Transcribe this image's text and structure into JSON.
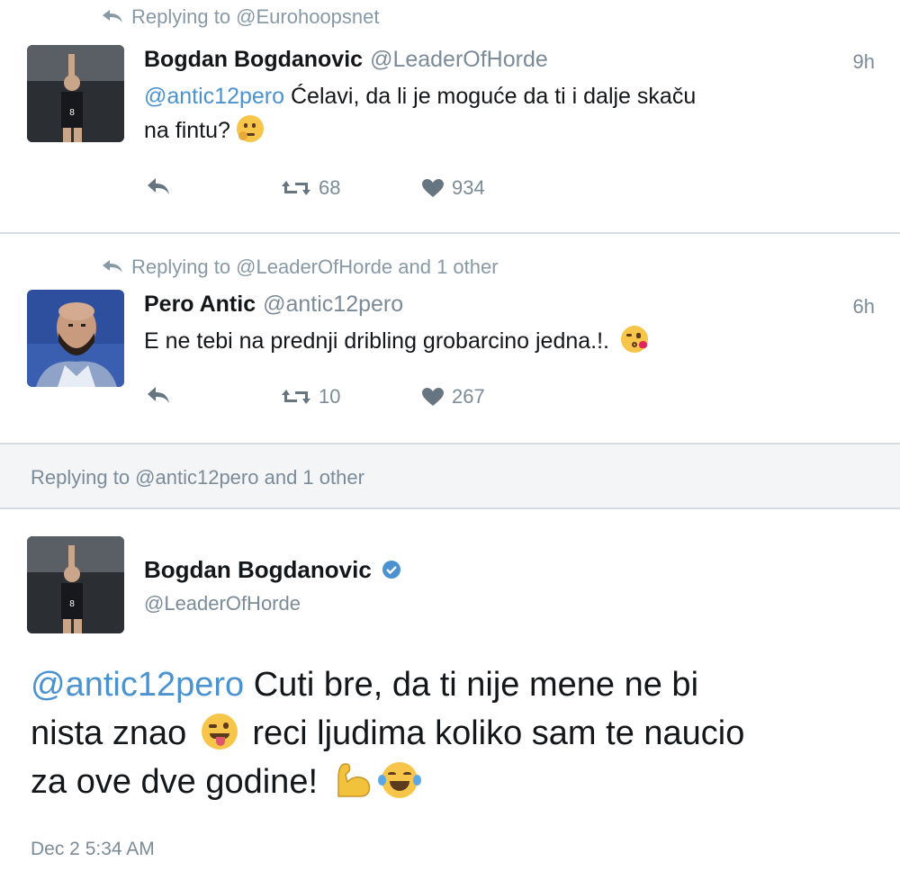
{
  "tweet1": {
    "replying_to": "Replying to @Eurohoopsnet",
    "display_name": "Bogdan Bogdanovic",
    "handle": "@LeaderOfHorde",
    "time": "9h",
    "mention": "@antic12pero",
    "text_line1": "Ćelavi, da li je moguće da ti i dalje skaču",
    "text_line2": "na fintu?",
    "emoji": "thinking-face",
    "retweets": "68",
    "likes": "934"
  },
  "tweet2": {
    "replying_to": "Replying to @LeaderOfHorde and 1 other",
    "display_name": "Pero Antic",
    "handle": "@antic12pero",
    "time": "6h",
    "text": "E ne tebi na prednji dribling grobarcino jedna.!.",
    "emoji": "face-blowing-kiss",
    "retweets": "10",
    "likes": "267"
  },
  "tweet3": {
    "replying_to": "Replying to @antic12pero and 1 other",
    "display_name": "Bogdan Bogdanovic",
    "verified_icon": "verified-badge-icon",
    "handle": "@LeaderOfHorde",
    "mention": "@antic12pero",
    "text_part1": "Cuti bre, da ti nije mene ne bi",
    "text_part2": "nista znao",
    "text_part3": "reci ljudima koliko sam te naucio",
    "text_part4": "za ove dve godine!",
    "emojis": [
      "winking-face-with-tongue",
      "flexed-biceps",
      "face-with-tears-of-joy"
    ],
    "timestamp": "Dec 2 5:34 AM"
  },
  "colors": {
    "link": "#4b92d0",
    "muted": "#8899a6",
    "divider": "#d5dbe0",
    "band": "#f3f5f7"
  }
}
